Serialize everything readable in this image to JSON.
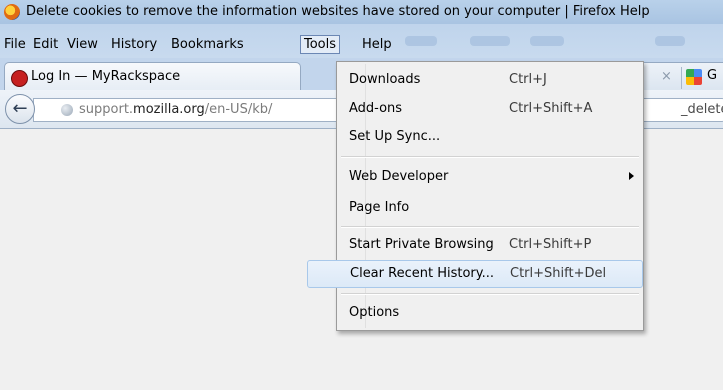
{
  "window": {
    "title": "Delete cookies to remove the information websites have stored on your computer | Firefox Help",
    "app_icon": "firefox-icon"
  },
  "menubar": {
    "items": [
      {
        "label": "File",
        "key": "F"
      },
      {
        "label": "Edit",
        "key": "E"
      },
      {
        "label": "View",
        "key": "V"
      },
      {
        "label": "History",
        "key": "s"
      },
      {
        "label": "Bookmarks",
        "key": "B"
      },
      {
        "label": "Tools",
        "key": "T",
        "open": true
      },
      {
        "label": "Help",
        "key": "H"
      }
    ]
  },
  "tabs": [
    {
      "title": "Log In — MyRackspace",
      "icon": "rackspace-icon"
    },
    {
      "title": "G",
      "icon": "google-icon",
      "close_glyph": "×"
    }
  ],
  "navbar": {
    "back_icon": "back-arrow-icon",
    "url_host_prefix": "support.",
    "url_host": "mozilla.org",
    "url_path": "/en-US/kb/",
    "url_tail": "_delete-all-"
  },
  "tools_menu": {
    "items": [
      {
        "label": "Downloads",
        "shortcut": "Ctrl+J"
      },
      {
        "label": "Add-ons",
        "shortcut": "Ctrl+Shift+A"
      },
      {
        "label": "Set Up Sync...",
        "shortcut": ""
      },
      {
        "label": "Web Developer",
        "shortcut": "",
        "submenu": true
      },
      {
        "label": "Page Info",
        "shortcut": ""
      },
      {
        "label": "Start Private Browsing",
        "shortcut": "Ctrl+Shift+P"
      },
      {
        "label": "Clear Recent History...",
        "shortcut": "Ctrl+Shift+Del",
        "highlighted": true
      },
      {
        "label": "Options",
        "shortcut": ""
      }
    ]
  },
  "colors": {
    "titlebar": "#b9d1ea",
    "menu_highlight": "#dce9f7",
    "page_background": "#f0f0f0"
  }
}
